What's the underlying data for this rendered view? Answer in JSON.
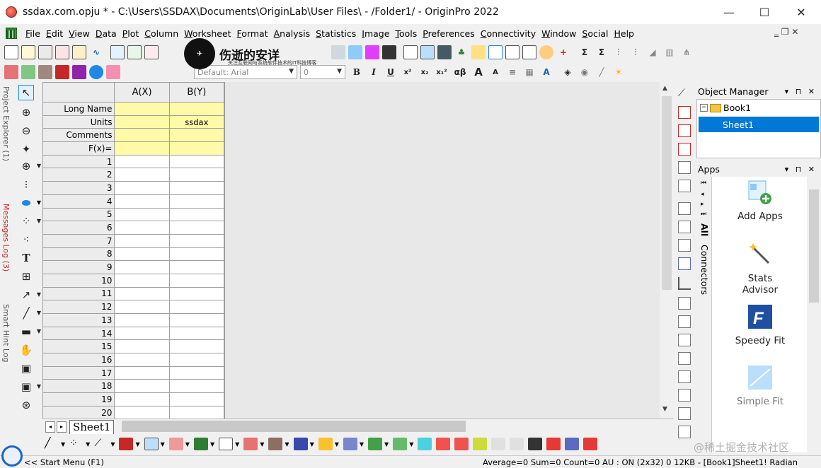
{
  "window": {
    "title": "ssdax.com.opju * - C:\\Users\\SSDAX\\Documents\\OriginLab\\User Files\\ - /Folder1/ - OriginPro 2022",
    "minimize_glyph": "—",
    "maximize_glyph": "☐",
    "close_glyph": "✕"
  },
  "menu": [
    "File",
    "Edit",
    "View",
    "Data",
    "Plot",
    "Column",
    "Worksheet",
    "Format",
    "Analysis",
    "Statistics",
    "Image",
    "Tools",
    "Preferences",
    "Connectivity",
    "Window",
    "Social",
    "Help"
  ],
  "mdi_controls": "‗  ❐  ✕",
  "watermark": {
    "title": "伤逝的安详",
    "subtitle": "关注互联网与系统软件技术的IT科技博客"
  },
  "format_toolbar": {
    "font_combo": "Default: Arial",
    "size_combo": "0",
    "bold": "B",
    "italic": "I",
    "underline": "U",
    "superscript": "x²",
    "subscript": "x₂",
    "supsub": "x₁²",
    "greek": "αβ",
    "grow_font": "A",
    "shrink_font": "A"
  },
  "side_tabs": {
    "project_explorer": "Project Explorer (1)",
    "messages_log": "Messages Log (3)",
    "smart_hint_log": "Smart Hint Log"
  },
  "worksheet": {
    "columns": [
      "A(X)",
      "B(Y)"
    ],
    "meta_rows": [
      {
        "label": "Long Name",
        "a": "",
        "b": ""
      },
      {
        "label": "Units",
        "a": "",
        "b": "ssdax"
      },
      {
        "label": "Comments",
        "a": "",
        "b": ""
      },
      {
        "label": "F(x)=",
        "a": "",
        "b": ""
      }
    ],
    "row_numbers": [
      "1",
      "2",
      "3",
      "4",
      "5",
      "6",
      "7",
      "8",
      "9",
      "10",
      "11",
      "12",
      "13",
      "14",
      "15",
      "16",
      "17",
      "18",
      "19",
      "20"
    ],
    "sheet_tab": "Sheet1"
  },
  "object_manager": {
    "title": "Object Manager",
    "book": "Book1",
    "sheet": "Sheet1"
  },
  "apps_panel": {
    "title": "Apps",
    "tab_all": "All",
    "tab_connectors": "Connectors",
    "apps": [
      "Add Apps",
      "Stats Advisor",
      "Speedy Fit",
      "Simple Fit"
    ]
  },
  "status": {
    "left": "<< Start Menu (F1)",
    "right": "Average=0 Sum=0 Count=0   AU : ON  (2x32) 0 12KB  -  [Book1]Sheet1! Radian"
  },
  "corner_watermark": "@稀土掘金技术社区"
}
